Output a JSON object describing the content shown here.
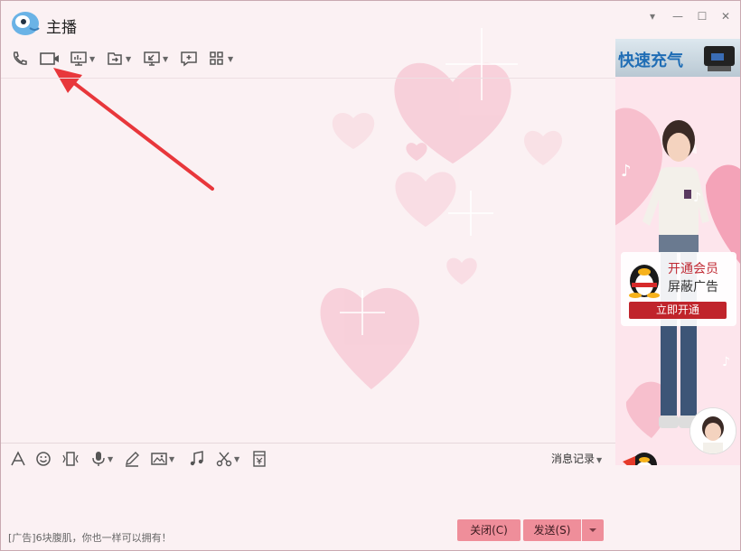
{
  "window": {
    "title": "主播"
  },
  "window_controls": [
    "dropdown",
    "minimize",
    "maximize",
    "close"
  ],
  "toolbar": {
    "items": [
      {
        "name": "phone-icon",
        "dropdown": false
      },
      {
        "name": "video-call-icon",
        "dropdown": false
      },
      {
        "name": "screen-share-icon",
        "dropdown": true
      },
      {
        "name": "file-transfer-icon",
        "dropdown": true
      },
      {
        "name": "remote-desktop-icon",
        "dropdown": true
      },
      {
        "name": "new-chat-icon",
        "dropdown": false
      },
      {
        "name": "apps-icon",
        "dropdown": true
      }
    ]
  },
  "input_toolbar": {
    "items": [
      "font-icon",
      "emoji-icon",
      "vibrate-icon",
      "voice-icon",
      "draw-icon",
      "image-icon",
      "music-icon",
      "screenshot-icon",
      "red-packet-icon"
    ],
    "history_label": "消息记录"
  },
  "footer": {
    "ad_text": "[广告]6块腹肌，你也一样可以拥有！",
    "close_label": "关闭(C)",
    "send_label": "发送(S)"
  },
  "side_panel": {
    "ad_top_text": "快速充气",
    "vip_title": "开通会员",
    "vip_sub": "屏蔽广告",
    "vip_button": "立即开通"
  },
  "colors": {
    "accent": "#ef8e9a",
    "vip_red": "#c0242b",
    "arrow_red": "#e8373b"
  }
}
